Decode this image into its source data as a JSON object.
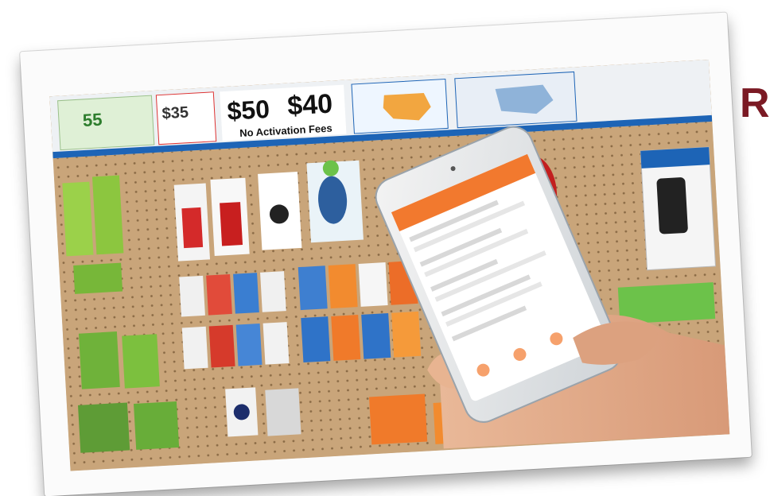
{
  "scene": {
    "side_letter": "R",
    "signs": {
      "price_a": "55",
      "price_b": "$35",
      "price_c": "$50",
      "price_d": "$40",
      "tagline": "No Activation Fees"
    },
    "phone_app": {
      "accent_color": "#f2792e"
    },
    "colors": {
      "pegboard": "#c9a57a",
      "sign_blue": "#1d64b6",
      "side_letter": "#7b1a24"
    }
  }
}
